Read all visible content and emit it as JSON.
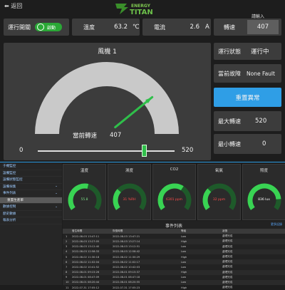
{
  "top": {
    "back_label": "返回",
    "rpm_input_label": "請輸入",
    "logo_line1": "ENERGY",
    "logo_line2": "TITAN"
  },
  "op_switch": {
    "label": "運行開關",
    "toggle_label": "啟動"
  },
  "temperature": {
    "label": "溫度",
    "value": "63.2",
    "unit": "℃"
  },
  "current": {
    "label": "電流",
    "value": "2.6",
    "unit": "A"
  },
  "speed_input": {
    "label": "轉速",
    "value": "407"
  },
  "fan": {
    "title": "風機 1",
    "current_speed_label": "當前轉速",
    "current_speed": "407",
    "min": "0",
    "max": "520",
    "needle_fraction": 0.783
  },
  "status": {
    "run_label": "運行狀態",
    "run_value": "運行中",
    "fault_label": "當前故障",
    "fault_value": "None Fault",
    "reset_button": "重置異常",
    "max_speed_label": "最大轉速",
    "max_speed": "520",
    "min_speed_label": "最小轉速",
    "min_speed": "0"
  },
  "sidebar": {
    "items": [
      "于機監控",
      "設備監控",
      "設備狀態監控",
      "設備採集",
      "事件列表",
      "重置生產單",
      "數據控制",
      "歷史數據",
      "報表分析"
    ]
  },
  "gauges": [
    {
      "title": "溫度",
      "value": "55.8",
      "fraction": 0.55,
      "color": "#39d353"
    },
    {
      "title": "濕度",
      "value": "31 %RH",
      "fraction": 0.31,
      "color": "#39d353",
      "value_color": "#ff4b4b"
    },
    {
      "title": "CO2",
      "value": "6301 ppm",
      "fraction": 0.63,
      "color": "#39d353",
      "value_color": "#ff4b4b"
    },
    {
      "title": "氧氣",
      "value": "32 ppm",
      "fraction": 0.32,
      "color": "#39d353",
      "value_color": "#ff4b4b"
    },
    {
      "title": "照度",
      "value": "836 lux",
      "fraction": 0.84,
      "color": "#39d353",
      "value_color": "#ffffff"
    }
  ],
  "events": {
    "title": "事件列表",
    "link": "更多記錄",
    "columns": [
      "",
      "發生時間",
      "恢復時間",
      "等級",
      "狀態"
    ],
    "rows": [
      [
        "1",
        "2022-08-03 13:47:11",
        "2022-08-03 13:47:21",
        "Low",
        "處理完成"
      ],
      [
        "2",
        "2022-08-03 13:27:05",
        "2022-08-03 13:27:14",
        "High",
        "處理完成"
      ],
      [
        "3",
        "2022-08-03 13:12:40",
        "2022-08-03 13:12:51",
        "Low",
        "處理完成"
      ],
      [
        "4",
        "2022-08-03 12:58:33",
        "2022-08-03 12:58:42",
        "Low",
        "處理完成"
      ],
      [
        "5",
        "2022-08-02 11:30:18",
        "2022-08-02 11:30:29",
        "High",
        "處理完成"
      ],
      [
        "6",
        "2022-08-02 11:02:04",
        "2022-08-02 11:02:17",
        "Low",
        "處理完成"
      ],
      [
        "7",
        "2022-08-02 10:41:52",
        "2022-08-02 10:42:03",
        "Low",
        "處理完成"
      ],
      [
        "8",
        "2022-08-01 09:15:26",
        "2022-08-01 09:15:37",
        "High",
        "處理完成"
      ],
      [
        "9",
        "2022-08-01 08:47:09",
        "2022-08-01 08:47:18",
        "Low",
        "處理完成"
      ],
      [
        "10",
        "2022-08-01 08:20:44",
        "2022-08-01 08:20:55",
        "Low",
        "處理完成"
      ],
      [
        "11",
        "2022-07-31 17:05:12",
        "2022-07-31 17:05:23",
        "High",
        "處理完成"
      ]
    ]
  },
  "colors": {
    "accent_blue": "#2f9ee6",
    "gauge_green": "#2ea043",
    "toggle_green": "#2aa836"
  }
}
